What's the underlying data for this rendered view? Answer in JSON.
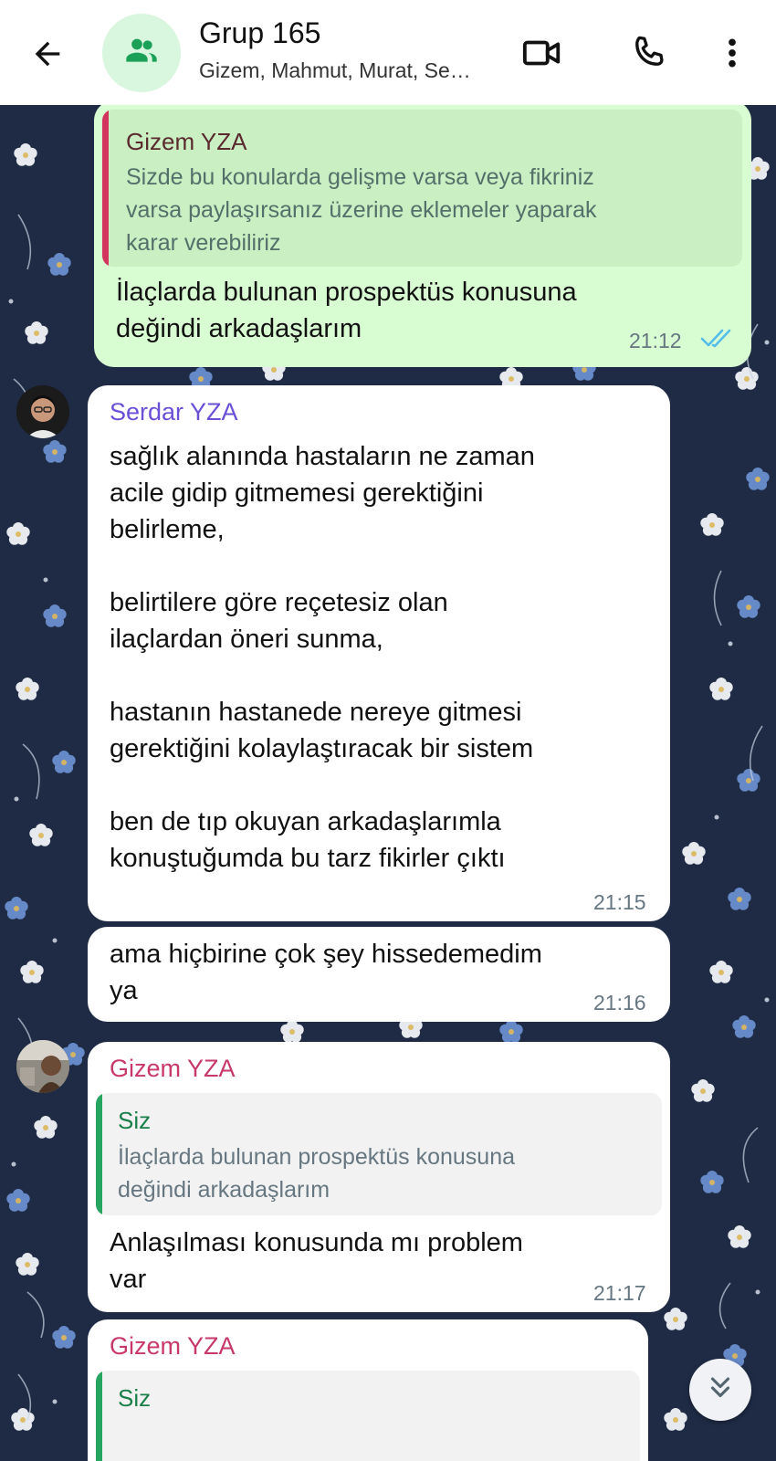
{
  "header": {
    "title": "Grup 165",
    "subtitle": "Gizem, Mahmut, Murat, Se…",
    "icons": [
      "back-arrow-icon",
      "group-icon",
      "video-call-icon",
      "phone-icon",
      "more-vert-icon"
    ]
  },
  "colors": {
    "outgoing_bubble": "#d9fdd3",
    "incoming_bubble": "#ffffff",
    "wallpaper": "#1f2b45",
    "gizem_name": "#c8396a",
    "serdar_name": "#6b4fd8",
    "own_quote_bar": "#25a55f",
    "gizem_quote_bar": "#d3345e",
    "read_ticks": "#53bdeb"
  },
  "messages": [
    {
      "quote_name": "Gizem YZA",
      "quote_text": "Sizde bu konularda gelişme varsa  veya fikriniz\nvarsa paylaşırsanız üzerine eklemeler yaparak\nkarar verebiliriz",
      "text": "İlaçlarda bulunan prospektüs konusuna\ndeğindi arkadaşlarım",
      "time": "21:12"
    },
    {
      "sender": "Serdar YZA",
      "text": "sağlık alanında hastaların ne zaman\nacile gidip gitmemesi gerektiğini\nbelirleme,\n\nbelirtilere göre reçetesiz olan\nilaçlardan öneri sunma,\n\nhastanın hastanede nereye gitmesi\ngerektiğini kolaylaştıracak bir sistem\n\nben de tıp okuyan arkadaşlarımla\nkonuştuğumda bu tarz fikirler çıktı",
      "time": "21:15"
    },
    {
      "text": "ama hiçbirine çok şey hissedemedim\nya",
      "time": "21:16"
    },
    {
      "sender": "Gizem YZA",
      "quote_name": "Siz",
      "quote_text": "İlaçlarda bulunan prospektüs konusuna\ndeğindi arkadaşlarım",
      "text": "Anlaşılması konusunda mı problem\nvar",
      "time": "21:17"
    },
    {
      "sender": "Gizem YZA",
      "quote_name": "Siz"
    }
  ]
}
